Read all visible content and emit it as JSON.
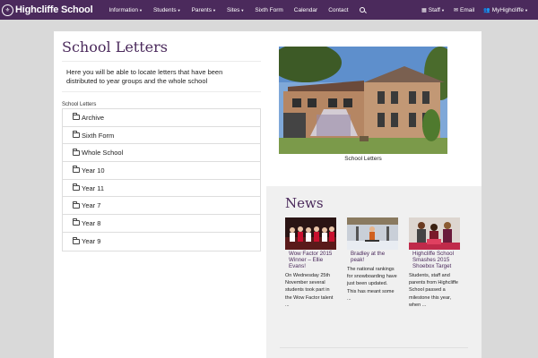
{
  "navbar": {
    "brand_logo": "⚜",
    "brand_name": "Highcliffe School",
    "items": [
      {
        "label": "Information",
        "caret": "▼"
      },
      {
        "label": "Students",
        "caret": "▼"
      },
      {
        "label": "Parents",
        "caret": "▼"
      },
      {
        "label": "Sites",
        "caret": "▼"
      },
      {
        "label": "Sixth Form"
      },
      {
        "label": "Calendar"
      },
      {
        "label": "Contact"
      }
    ],
    "right": {
      "staff": {
        "icon": "▦",
        "label": "Staff",
        "caret": "▼"
      },
      "email": {
        "icon": "✉",
        "label": "Email"
      },
      "my": {
        "icon": "👥",
        "label": "MyHighcliffe",
        "caret": "▼"
      }
    }
  },
  "page": {
    "title": "School Letters",
    "intro": "Here you will be able to locate letters that have been distributed to year groups and the whole school",
    "list_heading": "School Letters",
    "letters": [
      "Archive",
      "Sixth Form",
      "Whole School",
      "Year 10",
      "Year 11",
      "Year 7",
      "Year 8",
      "Year 9"
    ],
    "photo_caption": "School Letters"
  },
  "news": {
    "title": "News",
    "cards": [
      {
        "headline": "Wow Factor 2015 Winner – Ellie Evans!",
        "excerpt": "On Wednesday 25th November several students took part in the Wow Factor talent ..."
      },
      {
        "headline": "Bradley at the peak!",
        "excerpt": "The national rankings for snowboarding have just been updated. This has meant some ..."
      },
      {
        "headline": "Highcliffe School Smashes 2015 Shoebox Target",
        "excerpt": "Students, staff and parents from Highcliffe School passed a milestone this year, when ..."
      }
    ]
  },
  "colors": {
    "brand": "#4b2a5c",
    "page_bg": "#d9d9d9",
    "news_bg": "#f0f0f0"
  }
}
